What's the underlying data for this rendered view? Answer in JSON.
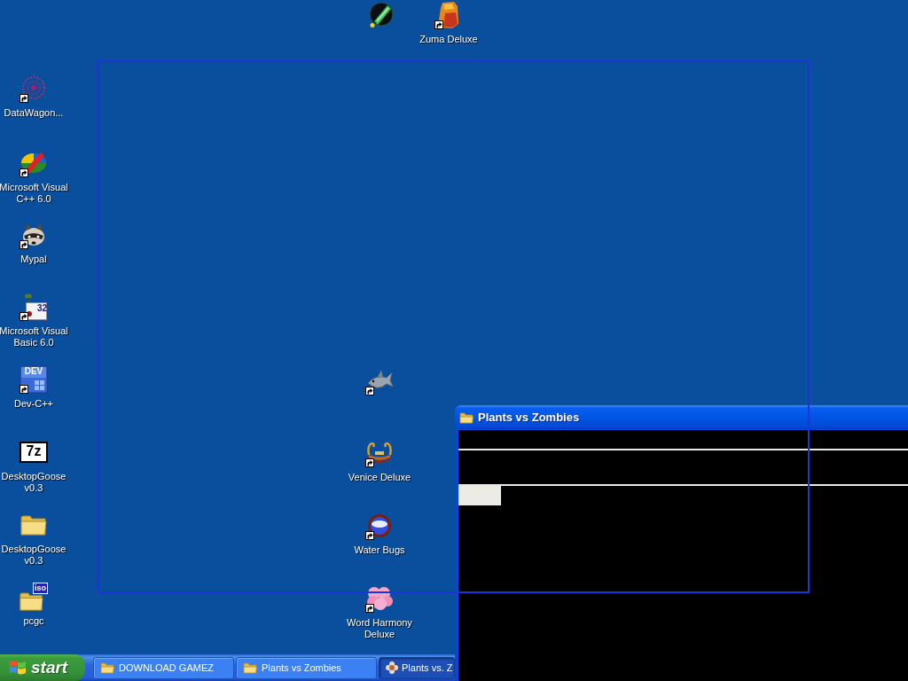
{
  "desktop": {
    "icons": [
      {
        "kind": "comet",
        "shortcut": false
      },
      {
        "kind": "stonehead",
        "label": "Zuma Deluxe",
        "shortcut": true
      },
      {
        "kind": "web",
        "label": "DataWagon...",
        "shortcut": true
      },
      {
        "kind": "oval",
        "label": "Microsoft Visual C++ 6.0",
        "shortcut": true
      },
      {
        "kind": "raccoon",
        "label": "Mypal",
        "shortcut": true
      },
      {
        "kind": "calendar",
        "label": "Microsoft Visual Basic 6.0",
        "shortcut": true,
        "badge": "32"
      },
      {
        "kind": "tile",
        "label": "Dev-C++",
        "shortcut": true,
        "badge": "DEV"
      },
      {
        "kind": "archive",
        "label": "DesktopGoose v0.3",
        "shortcut": false,
        "badge": "7z"
      },
      {
        "kind": "folder",
        "label": "DesktopGoose v0.3",
        "shortcut": false
      },
      {
        "kind": "isofolder",
        "label": "pcgc",
        "shortcut": false,
        "badge": "iso"
      },
      {
        "kind": "shark",
        "shortcut": true
      },
      {
        "kind": "gondola",
        "label": "Venice Deluxe",
        "shortcut": true
      },
      {
        "kind": "ring",
        "label": "Water Bugs",
        "shortcut": true
      },
      {
        "kind": "cloud",
        "label": "Word Harmony Deluxe",
        "shortcut": true
      }
    ]
  },
  "window": {
    "title": "Plants vs Zombies"
  },
  "taskbar": {
    "start_button": "start",
    "buttons": [
      {
        "kind": "folder",
        "label": "DOWNLOAD GAMEZ",
        "selected": false
      },
      {
        "kind": "folder",
        "label": "Plants vs Zombies",
        "selected": false
      },
      {
        "kind": "app",
        "label": "Plants vs. Z",
        "selected": true
      }
    ]
  }
}
